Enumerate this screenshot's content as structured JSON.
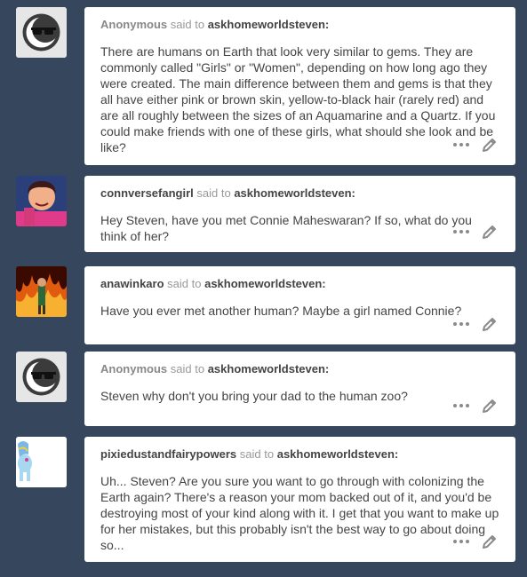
{
  "colors": {
    "page_bg": "#36465d",
    "card_bg": "#ffffff",
    "icon_gray": "#8a8a8a"
  },
  "posts": [
    {
      "asker": "Anonymous",
      "said_to": "said to",
      "recipient": "askhomeworldsteven:",
      "avatar_icon": "anonymous-sunglasses-icon",
      "body": "There are humans on Earth that look very similar to gems. They are commonly called \"Girls\" or \"Women\", depending on how long ago they were created. The main difference between them and gems is that they all have either pink or brown skin, yellow-to-black hair (rarely red) and are all roughly between the sizes of an Aquamarine and a Quartz. If you could make friends with one of these girls, what should she look and be like?"
    },
    {
      "asker": "connversefangirl",
      "said_to": "said to",
      "recipient": "askhomeworldsteven:",
      "avatar_icon": "steven-avatar-icon",
      "body": "Hey Steven, have you met Connie Maheswaran? If so, what do you think of her?"
    },
    {
      "asker": "anawinkaro",
      "said_to": "said to",
      "recipient": "askhomeworldsteven:",
      "avatar_icon": "fire-avatar-icon",
      "body": "Have you ever met another human? Maybe a girl named Connie?"
    },
    {
      "asker": "Anonymous",
      "said_to": "said to",
      "recipient": "askhomeworldsteven:",
      "avatar_icon": "anonymous-sunglasses-icon",
      "body": "Steven why don't you bring your dad to the human zoo?"
    },
    {
      "asker": "pixiedustandfairypowers",
      "said_to": "said to",
      "recipient": "askhomeworldsteven:",
      "avatar_icon": "pony-avatar-icon",
      "body": "Uh... Steven? Are you sure you want to go through with colonizing the Earth again? There's a reason your mom backed out of it, and you'd be destroying most of your kind along with it. I get that you want to make up for her mistakes, but this probably isn't the best way to go about doing so..."
    }
  ]
}
